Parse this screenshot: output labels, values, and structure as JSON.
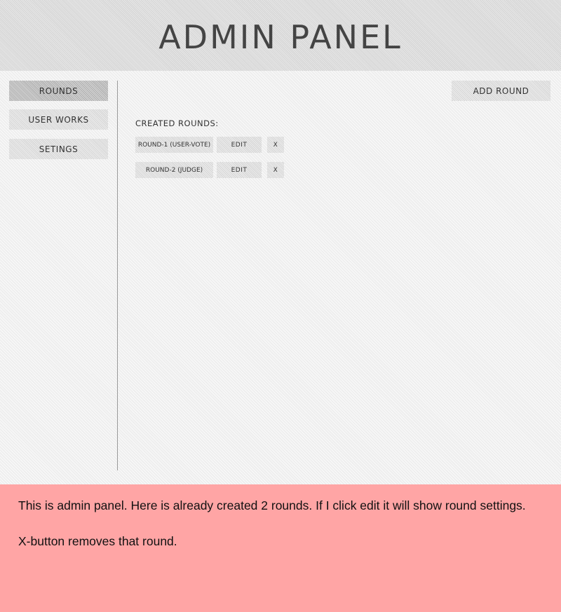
{
  "header": {
    "title": "ADMIN PANEL"
  },
  "sidebar": {
    "items": [
      {
        "label": "ROUNDS",
        "active": true
      },
      {
        "label": "USER WORKS",
        "active": false
      },
      {
        "label": "SETINGS",
        "active": false
      }
    ]
  },
  "main": {
    "add_round_label": "ADD ROUND",
    "section_label": "CREATED ROUNDS:",
    "rounds": [
      {
        "name": "ROUND-1 (USER-VOTE)",
        "edit_label": "EDIT",
        "remove_label": "X"
      },
      {
        "name": "ROUND-2 (JUDGE)",
        "edit_label": "EDIT",
        "remove_label": "X"
      }
    ]
  },
  "note": {
    "line1": "This is admin panel. Here is already created 2 rounds. If I click edit it will show round settings.",
    "line2": "X-button removes that round."
  },
  "colors": {
    "active_nav": "#b3b3b3",
    "button": "#dedede",
    "note_background": "#ffa5a5"
  }
}
